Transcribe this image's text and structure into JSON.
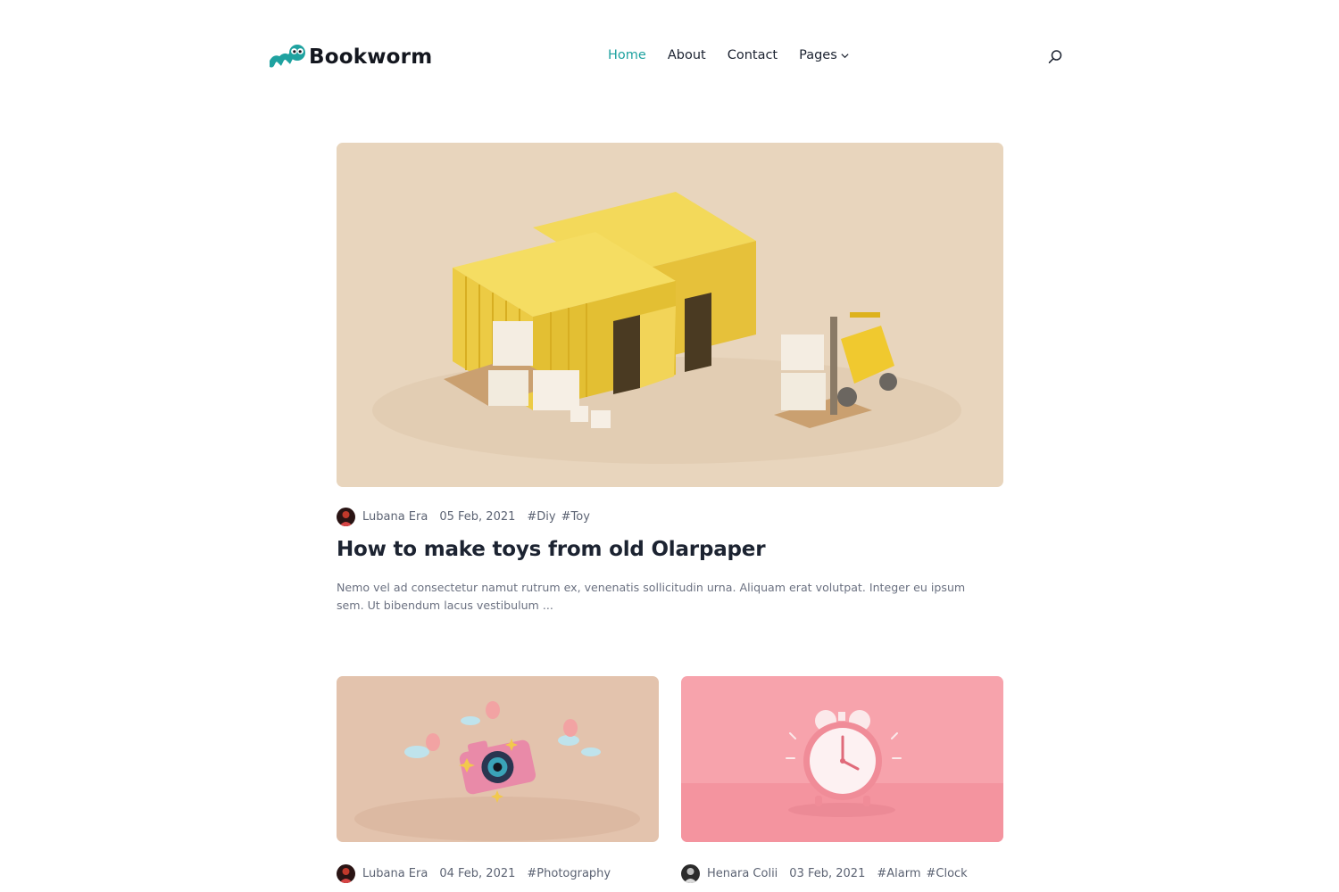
{
  "brand": {
    "name": "Bookworm",
    "accent": "#1fa2a0"
  },
  "nav": {
    "items": [
      {
        "label": "Home",
        "active": true
      },
      {
        "label": "About",
        "active": false
      },
      {
        "label": "Contact",
        "active": false
      },
      {
        "label": "Pages",
        "active": false,
        "has_dropdown": true
      }
    ],
    "search_icon": "search-icon"
  },
  "featured": {
    "image": "shipping-containers-forklift-illustration",
    "author": "Lubana Era",
    "date": "05 Feb, 2021",
    "tags": [
      "#Diy",
      "#Toy"
    ],
    "title": "How to make toys from old Olarpaper",
    "excerpt": "Nemo vel ad consectetur namut rutrum ex, venenatis sollicitudin urna. Aliquam erat volutpat. Integer eu ipsum sem. Ut bibendum lacus vestibulum ..."
  },
  "cards": [
    {
      "image": "camera-balloons-illustration",
      "author": "Lubana Era",
      "date": "04 Feb, 2021",
      "tags": [
        "#Photography"
      ]
    },
    {
      "image": "alarm-clock-illustration",
      "author": "Henara Colii",
      "date": "03 Feb, 2021",
      "tags": [
        "#Alarm",
        "#Clock"
      ]
    }
  ]
}
